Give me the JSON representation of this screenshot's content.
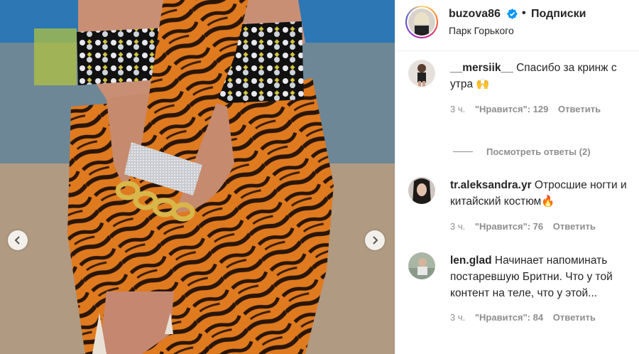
{
  "header": {
    "username": "buzova86",
    "separator": "•",
    "follow_label": "Подписки",
    "location": "Парк Горького"
  },
  "media": {
    "prev_icon": "chevron-left-icon",
    "next_icon": "chevron-right-icon"
  },
  "comments": [
    {
      "username": "__mersiik__",
      "text": "Спасибо за кринж с утра 🙌",
      "time": "3 ч.",
      "likes": "\"Нравится\": 129",
      "reply_label": "Ответить"
    },
    {
      "username": "tr.aleksandra.yr",
      "text": "Отросшие ногти и китайский костюм🔥",
      "time": "3 ч.",
      "likes": "\"Нравится\": 76",
      "reply_label": "Ответить"
    },
    {
      "username": "len.glad",
      "text": "Начинает напоминать постаревшую Бритни. Что у той контент на теле, что у этой...",
      "time": "3 ч.",
      "likes": "\"Нравится\": 84",
      "reply_label": "Ответить"
    }
  ],
  "view_replies": "Посмотреть ответы (2)",
  "colors": {
    "verified": "#0095f6",
    "muted": "#8e8e8e",
    "text": "#262626"
  }
}
